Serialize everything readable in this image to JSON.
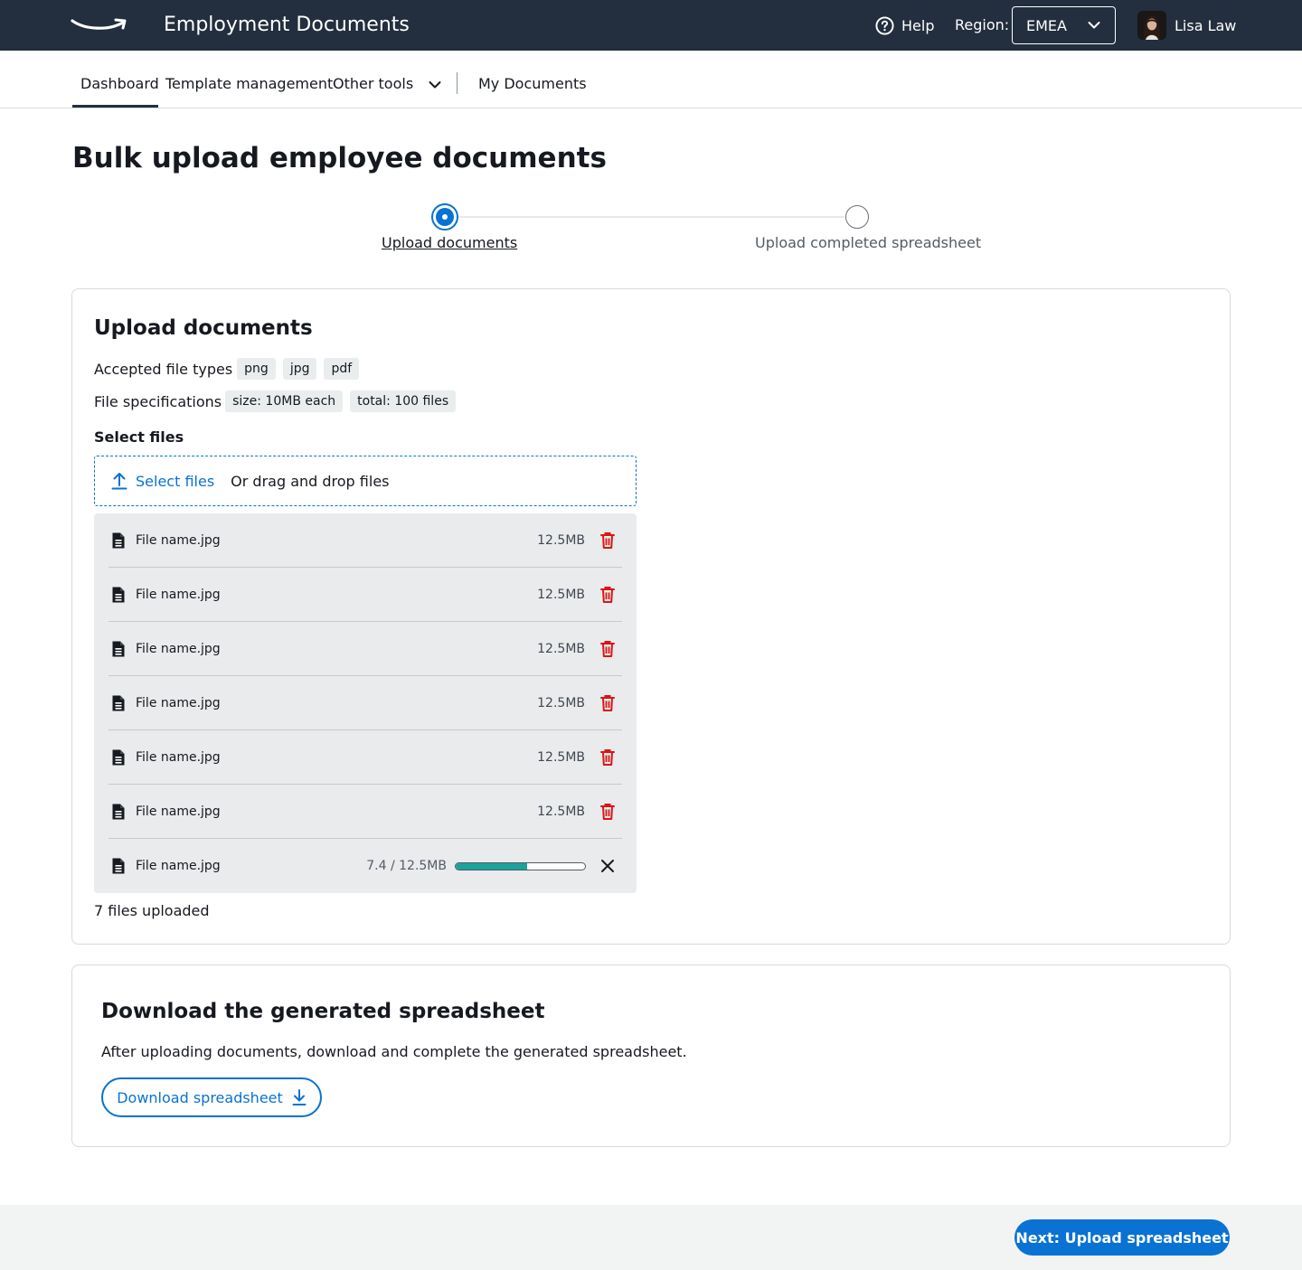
{
  "header": {
    "app_title": "Employment Documents",
    "help_label": "Help",
    "region_label": "Region:",
    "region_value": "EMEA",
    "user_name": "Lisa Law"
  },
  "subnav": {
    "items": [
      {
        "label": "Dashboard",
        "active": true
      },
      {
        "label": "Template management"
      },
      {
        "label": "Other tools"
      },
      {
        "label": "My Documents"
      }
    ]
  },
  "page": {
    "title": "Bulk upload employee documents"
  },
  "stepper": {
    "steps": [
      {
        "label": "Upload documents",
        "state": "current"
      },
      {
        "label": "Upload completed spreadsheet",
        "state": "upcoming"
      }
    ]
  },
  "upload_card": {
    "title": "Upload documents",
    "accepted_label": "Accepted file types",
    "accepted_types": [
      "png",
      "jpg",
      "pdf"
    ],
    "specs_label": "File specifications",
    "specs": [
      "size: 10MB each",
      "total: 100 files"
    ],
    "select_label": "Select files",
    "select_button": "Select files",
    "drag_text": "Or drag and drop files",
    "files": [
      {
        "name": "File name.jpg",
        "size": "12.5MB"
      },
      {
        "name": "File name.jpg",
        "size": "12.5MB"
      },
      {
        "name": "File name.jpg",
        "size": "12.5MB"
      },
      {
        "name": "File name.jpg",
        "size": "12.5MB"
      },
      {
        "name": "File name.jpg",
        "size": "12.5MB"
      },
      {
        "name": "File name.jpg",
        "size": "12.5MB"
      }
    ],
    "uploading_file": {
      "name": "File name.jpg",
      "progress_text": "7.4 / 12.5MB",
      "progress": 0.55
    },
    "files_count": "7 files uploaded"
  },
  "download_card": {
    "title": "Download the generated spreadsheet",
    "description": "After uploading documents, download and complete the generated spreadsheet.",
    "button": "Download spreadsheet"
  },
  "footer": {
    "next_button": "Next: Upload spreadsheet"
  },
  "colors": {
    "header_bg": "#232f3e",
    "accent": "#0972d3",
    "delete": "#d91515",
    "progress": "#1aa39a",
    "list_bg": "#e9ebed"
  }
}
